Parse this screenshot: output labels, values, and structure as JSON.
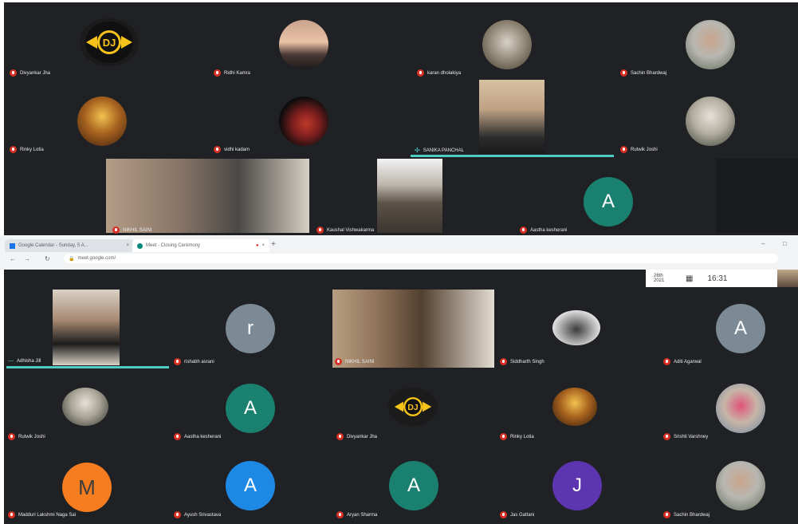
{
  "browser": {
    "tabs": [
      "Google Calendar - Sunday, 5 A...",
      "Meet - Closing Ceremony"
    ],
    "new_tab": "+",
    "url": "meet.google.com/",
    "window_controls": [
      "–",
      "□"
    ]
  },
  "meet_info": {
    "date": "26th 2021",
    "time": "16:31"
  },
  "top_grid": [
    {
      "name": "Divyankar Jha",
      "avatar": "dj-logo"
    },
    {
      "name": "Ridhi Kamra",
      "avatar": "sunset-photo"
    },
    {
      "name": "karan dholakiya",
      "avatar": "photo"
    },
    {
      "name": "Sachin Bhardwaj",
      "avatar": "photo"
    },
    {
      "name": "Rinky Lotia",
      "avatar": "sai-photo"
    },
    {
      "name": "vidhi kadam",
      "avatar": "dancer-photo"
    },
    {
      "name": "SANIKA PANCHAL",
      "avatar": "video"
    },
    {
      "name": "Rutwik Joshi",
      "avatar": "photo"
    },
    {
      "name": "NIKHIL SAINI",
      "avatar": "video"
    },
    {
      "name": "Kaushal Vishwakarma",
      "avatar": "video"
    },
    {
      "name": "Aastha kesherani",
      "avatar": "A"
    }
  ],
  "bottom_grid": [
    {
      "name": "Adhisha Jill",
      "avatar": "video"
    },
    {
      "name": "rishabh asrani",
      "avatar": "r"
    },
    {
      "name": "NIKHIL SAINI",
      "avatar": "video"
    },
    {
      "name": "Siddharth Singh",
      "avatar": "car-photo"
    },
    {
      "name": "Aditi Agarwal",
      "avatar": "A"
    },
    {
      "name": "Rutwik Joshi",
      "avatar": "photo"
    },
    {
      "name": "Aastha kesherani",
      "avatar": "A"
    },
    {
      "name": "Divyankar Jha",
      "avatar": "dj-logo"
    },
    {
      "name": "Rinky Lotia",
      "avatar": "sai-photo"
    },
    {
      "name": "Srishti Varshney",
      "avatar": "photo"
    },
    {
      "name": "Madduri Lakshmi Naga Sai",
      "avatar": "M"
    },
    {
      "name": "Ayush Srivastava",
      "avatar": "A"
    },
    {
      "name": "Aryan Sharma",
      "avatar": "A"
    },
    {
      "name": "Jas Gattani",
      "avatar": "J"
    },
    {
      "name": "Sachin Bhardwaj",
      "avatar": "photo"
    }
  ],
  "avatar_colors": {
    "teal": "#1a8070",
    "grey": "#7b8a94",
    "blue": "#1e88e5",
    "purple": "#5e35b1",
    "orange": "#f57c1f"
  },
  "dj_logo_text": "DJ"
}
